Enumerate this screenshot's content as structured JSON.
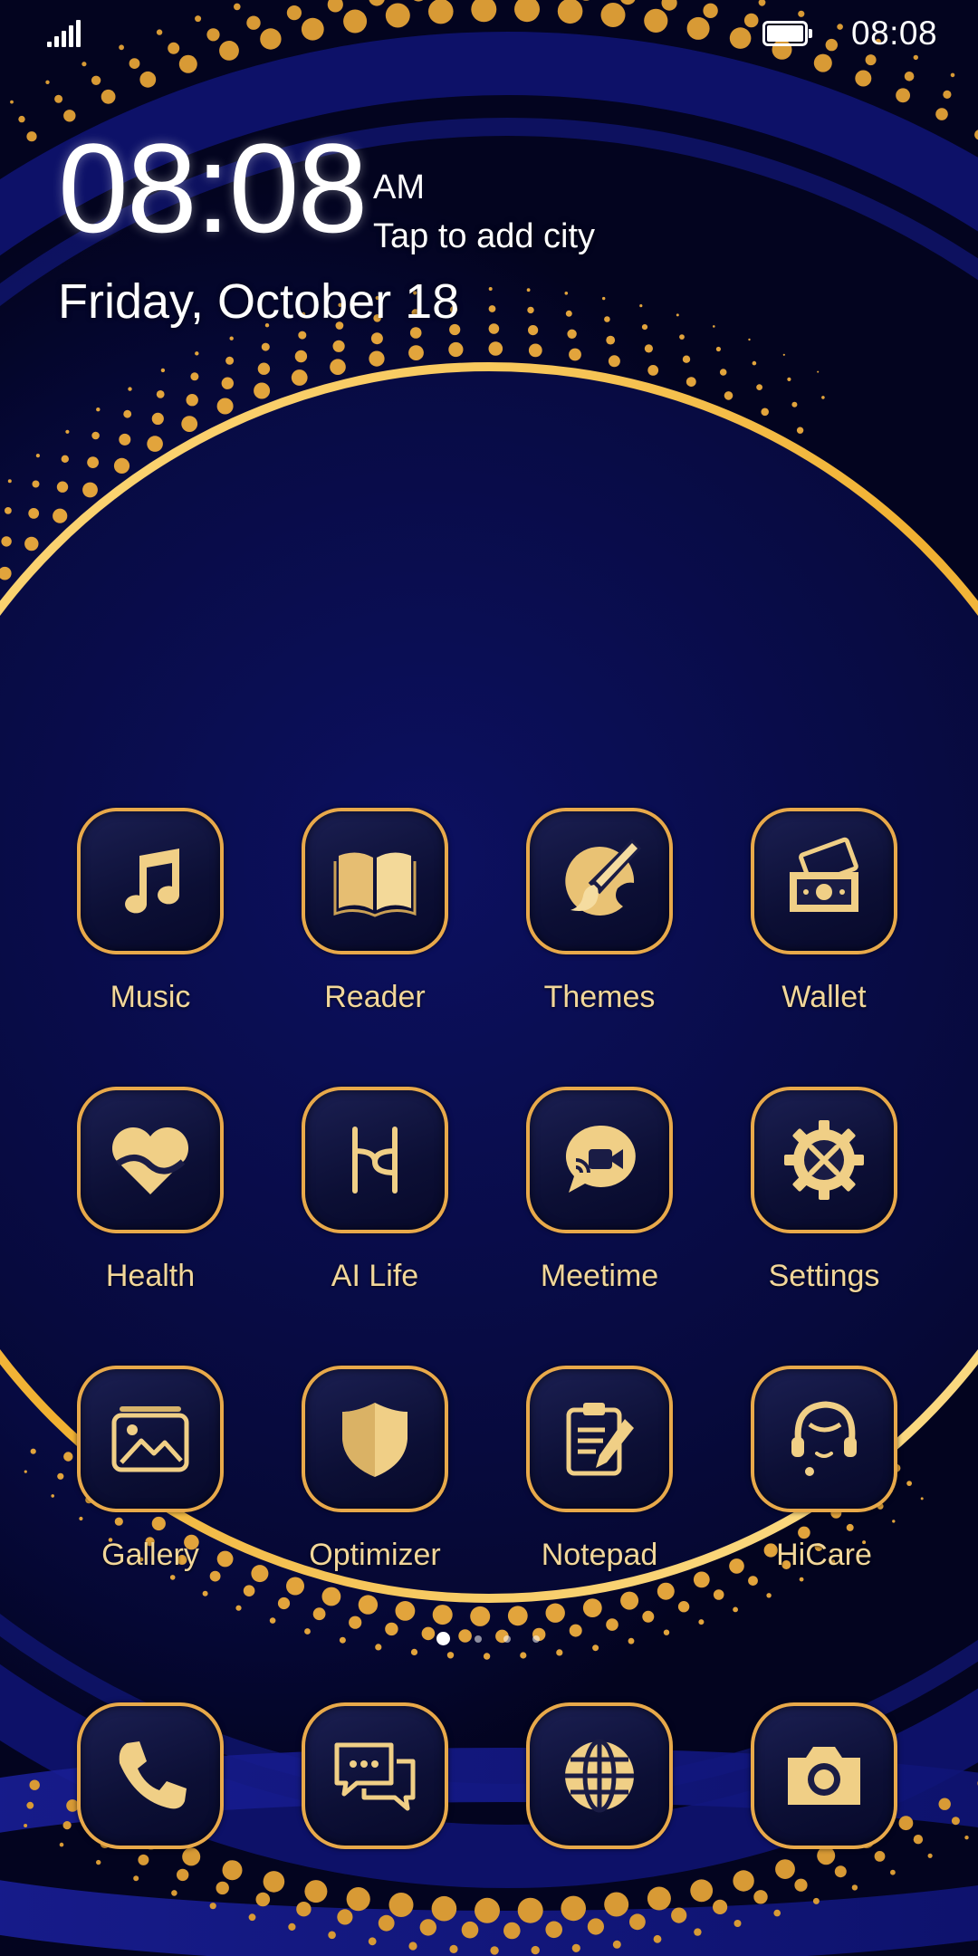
{
  "status_bar": {
    "time": "08:08",
    "signal_icon": "signal-bars-icon",
    "battery_icon": "battery-full-icon"
  },
  "clock_widget": {
    "time": "08:08",
    "ampm": "AM",
    "city_prompt": "Tap to add city",
    "date": "Friday, October 18"
  },
  "theme_colors": {
    "gold": "#e8a94a",
    "gold_light": "#f2d79a",
    "background": "#0a0f55"
  },
  "apps": [
    {
      "label": "Music",
      "icon": "music-note-icon"
    },
    {
      "label": "Reader",
      "icon": "open-book-icon"
    },
    {
      "label": "Themes",
      "icon": "paintbrush-palette-icon"
    },
    {
      "label": "Wallet",
      "icon": "wallet-cash-icon"
    },
    {
      "label": "Health",
      "icon": "heart-icon"
    },
    {
      "label": "AI Life",
      "icon": "ai-life-icon"
    },
    {
      "label": "Meetime",
      "icon": "video-call-bubble-icon"
    },
    {
      "label": "Settings",
      "icon": "gear-tools-icon"
    },
    {
      "label": "Gallery",
      "icon": "photo-stack-icon"
    },
    {
      "label": "Optimizer",
      "icon": "shield-icon"
    },
    {
      "label": "Notepad",
      "icon": "clipboard-pencil-icon"
    },
    {
      "label": "HiCare",
      "icon": "headset-person-icon"
    }
  ],
  "page_indicator": {
    "pages": 4,
    "current": 1
  },
  "dock": [
    {
      "icon": "phone-icon"
    },
    {
      "icon": "messages-icon"
    },
    {
      "icon": "browser-globe-icon"
    },
    {
      "icon": "camera-icon"
    }
  ]
}
